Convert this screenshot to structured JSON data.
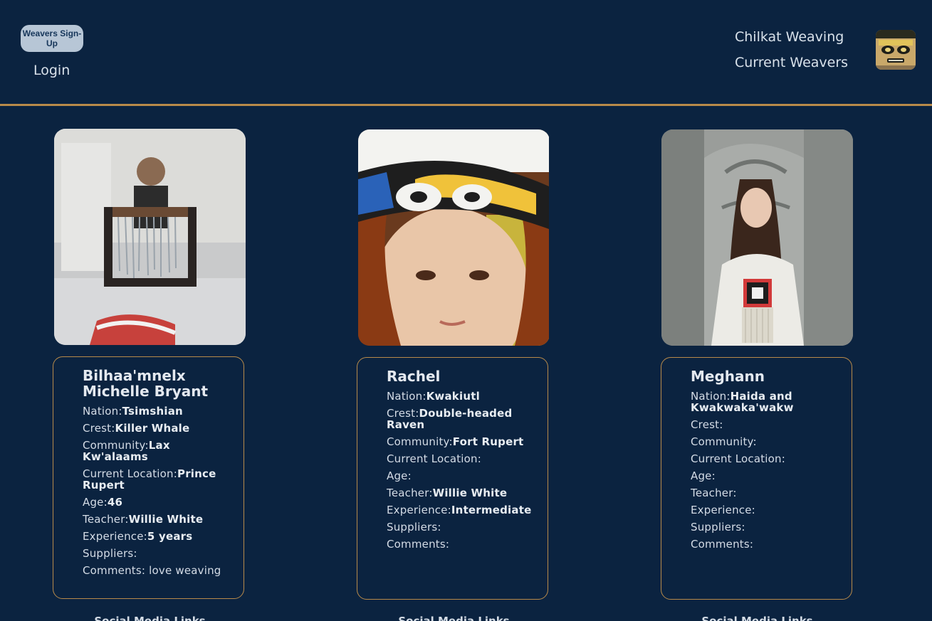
{
  "header": {
    "signup_label": "Weavers Sign-Up",
    "login_label": "Login",
    "nav": [
      "Chilkat Weaving",
      "Current Weavers"
    ],
    "logo_icon": "chilkat-mask-logo-icon"
  },
  "colors": {
    "background": "#0b2340",
    "accent": "#b88a4a",
    "button": "#b7c6d6"
  },
  "weavers": [
    {
      "name": "Bilhaa'mnelx Michelle Bryant",
      "photo": "weaver-at-loom-photo",
      "fields": [
        {
          "label": "Nation:",
          "value": "Tsimshian"
        },
        {
          "label": "Crest:",
          "value": "Killer Whale"
        },
        {
          "label": "Community:",
          "value": "Lax Kw'alaams"
        },
        {
          "label": "Current Location:",
          "value": "Prince Rupert"
        },
        {
          "label": "Age:",
          "value": "46"
        },
        {
          "label": "Teacher:",
          "value": "Willie White"
        },
        {
          "label": "Experience:",
          "value": "5 years"
        },
        {
          "label": "Suppliers:",
          "value": ""
        },
        {
          "label": "Comments:",
          "value": " love weaving",
          "plain": true
        }
      ],
      "social": "Social Media Links"
    },
    {
      "name": "Rachel",
      "photo": "child-in-headband-photo",
      "fields": [
        {
          "label": "Nation:",
          "value": "Kwakiutl"
        },
        {
          "label": "Crest:",
          "value": "Double-headed Raven"
        },
        {
          "label": "Community:",
          "value": "Fort Rupert"
        },
        {
          "label": "Current Location:",
          "value": ""
        },
        {
          "label": "Age:",
          "value": ""
        },
        {
          "label": "Teacher:",
          "value": "Willie White"
        },
        {
          "label": "Experience:",
          "value": "Intermediate"
        },
        {
          "label": "Suppliers:",
          "value": ""
        },
        {
          "label": "Comments:",
          "value": ""
        }
      ],
      "social": "Social Media Links"
    },
    {
      "name": "Meghann",
      "photo": "woman-at-carved-pole-photo",
      "fields": [
        {
          "label": "Nation:",
          "value": "Haida and Kwakwaka'wakw"
        },
        {
          "label": "Crest:",
          "value": ""
        },
        {
          "label": "Community:",
          "value": ""
        },
        {
          "label": "Current Location:",
          "value": ""
        },
        {
          "label": "Age:",
          "value": ""
        },
        {
          "label": "Teacher:",
          "value": ""
        },
        {
          "label": "Experience:",
          "value": ""
        },
        {
          "label": "Suppliers:",
          "value": ""
        },
        {
          "label": "Comments:",
          "value": ""
        }
      ],
      "social": "Social Media Links"
    }
  ]
}
